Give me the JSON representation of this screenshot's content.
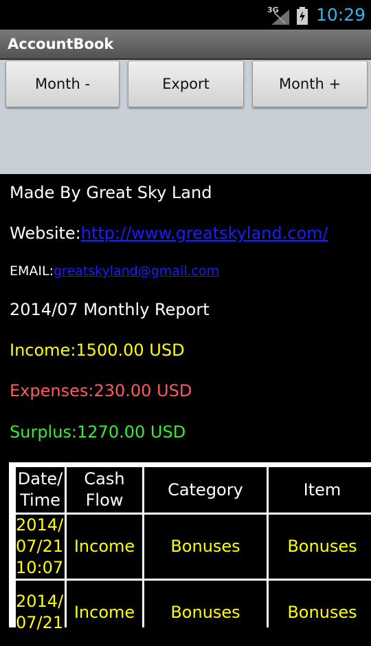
{
  "status_bar": {
    "network": "3G",
    "time": "10:29"
  },
  "app": {
    "title": "AccountBook"
  },
  "toolbar": {
    "month_minus": "Month -",
    "export": "Export",
    "month_plus": "Month +"
  },
  "info": {
    "made_by": "Made By Great Sky Land",
    "website_label": "Website:",
    "website_url": "http://www.greatskyland.com/",
    "email_label": "EMAIL:",
    "email": "greatskyland@gmail.com",
    "report_title": "2014/07 Monthly Report",
    "income": "Income:1500.00 USD",
    "expenses": "Expenses:230.00 USD",
    "surplus": "Surplus:1270.00 USD"
  },
  "table": {
    "headers": [
      "Date/\nTime",
      "Cash\nFlow",
      "Category",
      "Item"
    ],
    "rows": [
      [
        "2014/\n07/21\n10:07",
        "Income",
        "Bonuses",
        "Bonuses"
      ],
      [
        "2014/\n07/21",
        "Income",
        "Bonuses",
        "Bonuses"
      ]
    ]
  },
  "colors": {
    "income": "#ffff00",
    "expenses": "#ff5a5a",
    "surplus": "#33ee33",
    "clock": "#33b5e5",
    "link": "#1c1cff"
  }
}
